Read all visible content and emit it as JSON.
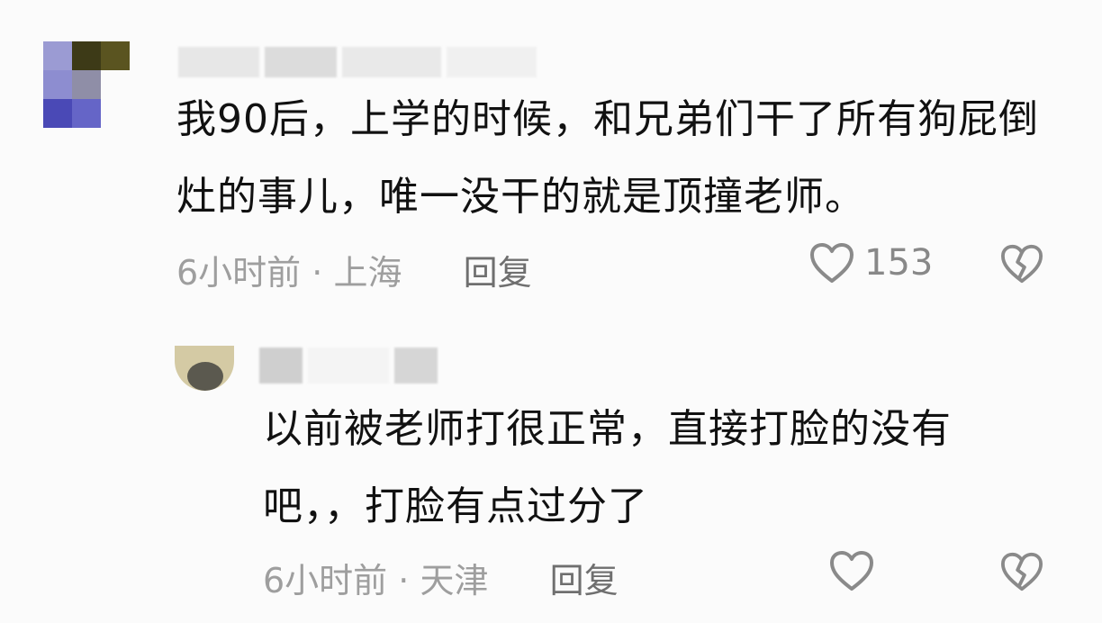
{
  "comments": [
    {
      "text": "我90后，上学的时候，和兄弟们干了所有狗屁倒灶的事儿，唯一没干的就是顶撞老师。",
      "time": "6小时前",
      "location": "上海",
      "reply_label": "回复",
      "like_count": "153"
    },
    {
      "text": "以前被老师打很正常，直接打脸的没有吧，，打脸有点过分了",
      "time": "6小时前",
      "location": "天津",
      "reply_label": "回复",
      "like_count": ""
    }
  ],
  "icons": {
    "like": "heart-outline-icon",
    "dislike": "broken-heart-icon"
  },
  "colors": {
    "text": "#111111",
    "meta": "#9e9e9e",
    "icon": "#8a8a8a"
  }
}
